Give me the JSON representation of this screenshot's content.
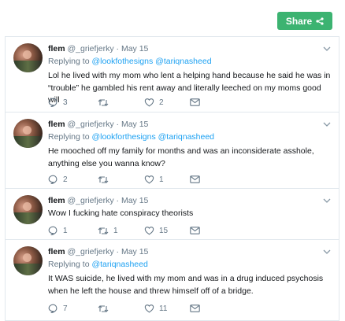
{
  "share": {
    "label": "Share"
  },
  "tweets": [
    {
      "name": "flem",
      "handle": "@_griefjerky",
      "date": "May 15",
      "replying_prefix": "Replying to",
      "replying_to": "@lookfothesigns @tariqnasheed",
      "text": "Lol he lived with my mom who lent a helping hand because he said he was in “trouble” he gambled his rent away and literally leeched on my moms good will",
      "replies": "3",
      "retweets": "",
      "likes": "2"
    },
    {
      "name": "flem",
      "handle": "@_griefjerky",
      "date": "May 15",
      "replying_prefix": "Replying to",
      "replying_to": "@lookforthesigns @tariqnasheed",
      "text": "He mooched off my family for months and was an inconsiderate asshole, anything else you wanna know?",
      "replies": "2",
      "retweets": "",
      "likes": "1"
    },
    {
      "name": "flem",
      "handle": "@_griefjerky",
      "date": "May 15",
      "replying_prefix": "",
      "replying_to": "",
      "text": "Wow I fucking hate conspiracy theorists",
      "replies": "1",
      "retweets": "1",
      "likes": "15"
    },
    {
      "name": "flem",
      "handle": "@_griefjerky",
      "date": "May 15",
      "replying_prefix": "Replying to",
      "replying_to": "@tariqnasheed",
      "text": "It WAS suicide, he lived with my mom and was in a drug induced psychosis when he left the house and threw himself off of a bridge.",
      "replies": "7",
      "retweets": "",
      "likes": "11"
    }
  ],
  "icons": {
    "reply": "reply-icon",
    "retweet": "retweet-icon",
    "like": "heart-icon",
    "dm": "envelope-icon",
    "menu": "chevron-down-icon",
    "share": "share-icon"
  },
  "colors": {
    "share_button": "#3cb371",
    "link": "#1da1f2",
    "muted": "#657786",
    "text": "#14171a",
    "border": "#e1e8ed"
  }
}
